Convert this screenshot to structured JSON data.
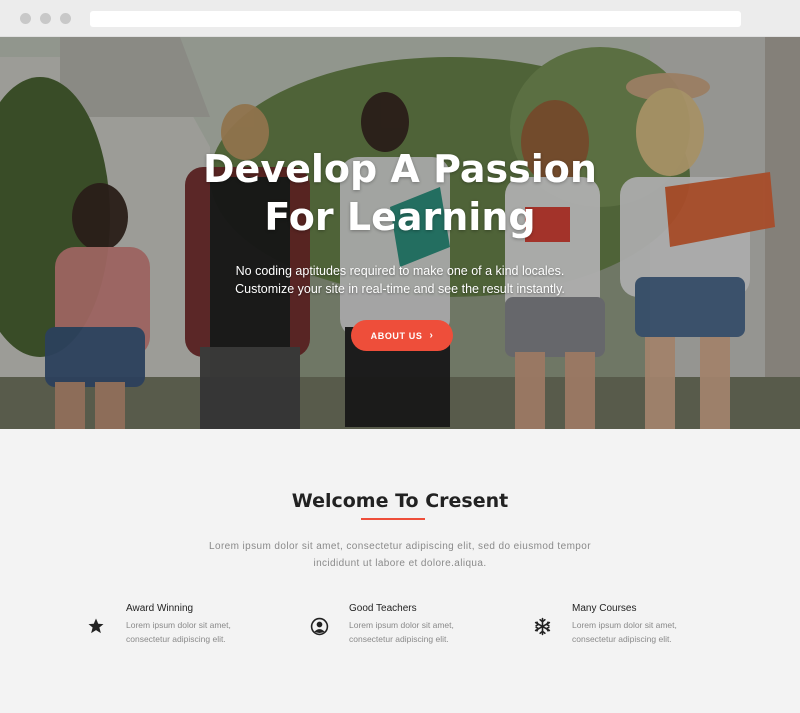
{
  "hero": {
    "title_line1": "Develop A Passion",
    "title_line2": "For Learning",
    "subtitle_line1": "No coding aptitudes required to make one of a kind locales.",
    "subtitle_line2": "Customize your site in real-time and see the result instantly.",
    "button_label": "ABOUT US",
    "button_icon": "chevron-right-icon",
    "accent_color": "#ee4e3a"
  },
  "welcome": {
    "title": "Welcome To Cresent",
    "text_line1": "Lorem ipsum dolor sit amet, consectetur adipiscing elit, sed do eiusmod tempor",
    "text_line2": "incididunt ut labore et dolore.aliqua."
  },
  "features": [
    {
      "icon": "star-icon",
      "title": "Award Winning",
      "desc_line1": "Lorem ipsum dolor sit amet,",
      "desc_line2": "consectetur adipiscing elit."
    },
    {
      "icon": "user-icon",
      "title": "Good Teachers",
      "desc_line1": "Lorem ipsum dolor sit amet,",
      "desc_line2": "consectetur adipiscing elit."
    },
    {
      "icon": "snowflake-icon",
      "title": "Many Courses",
      "desc_line1": "Lorem ipsum dolor sit amet,",
      "desc_line2": "consectetur adipiscing elit."
    }
  ]
}
